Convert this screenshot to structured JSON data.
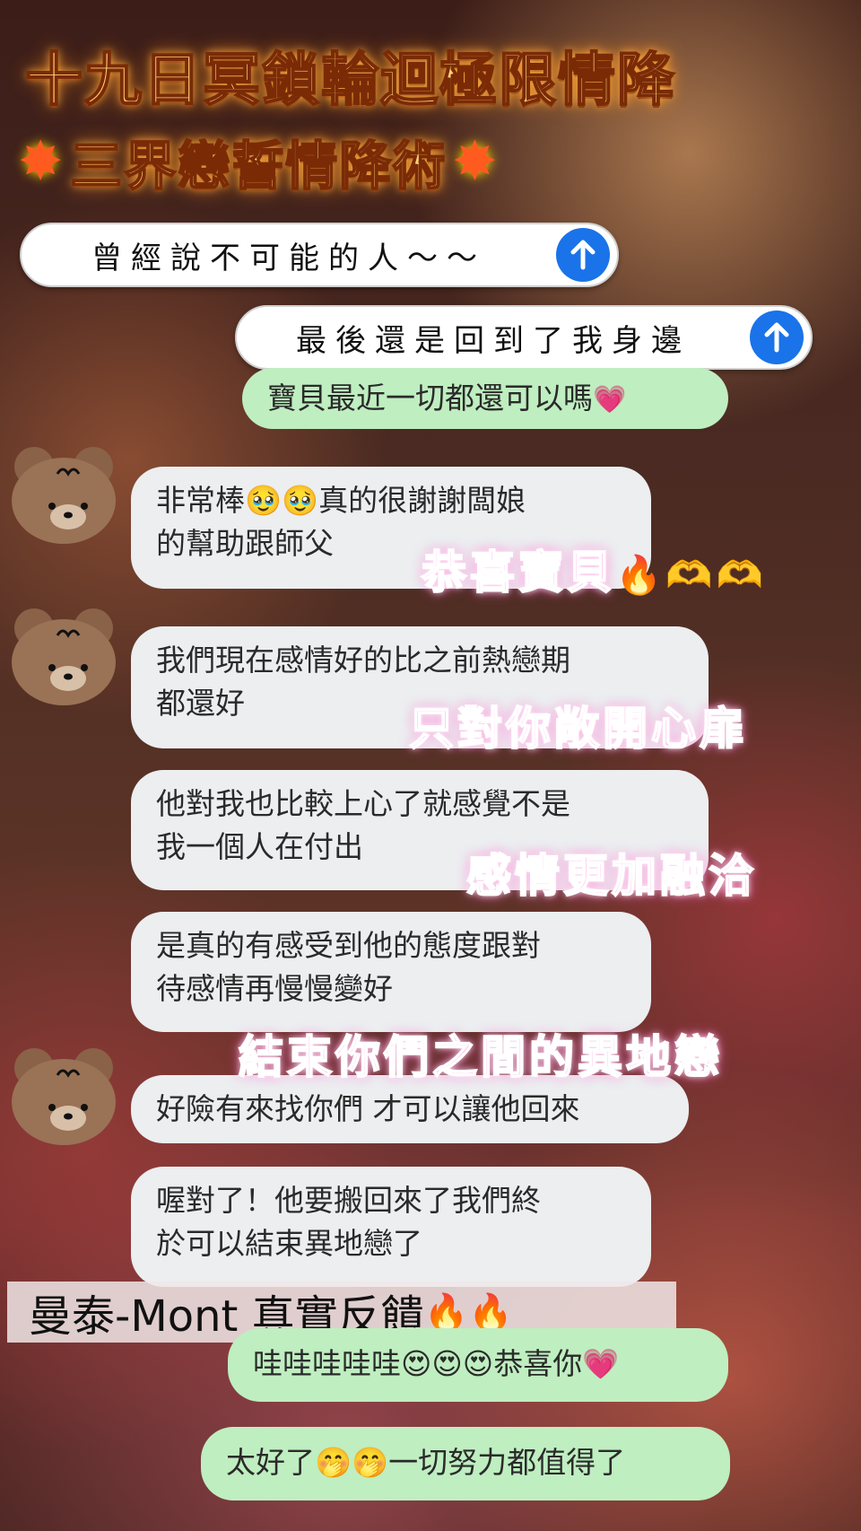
{
  "headline": {
    "line1": "十九日冥鎖輪迴極限情降",
    "line2": "三界戀誓情降術",
    "spark_icon": "✸"
  },
  "pills": [
    {
      "text": "曾經說不可能的人～～"
    },
    {
      "text": "最後還是回到了我身邊"
    }
  ],
  "messages": [
    {
      "type": "green",
      "text": "寶貝最近一切都還可以嗎",
      "emoji": "💗"
    },
    {
      "type": "gray",
      "line1": "非常棒🥹🥹真的很謝謝闆娘",
      "line2": "的幫助跟師父"
    },
    {
      "type": "gray",
      "line1": "我們現在感情好的比之前熱戀期",
      "line2": "都還好"
    },
    {
      "type": "gray",
      "line1": "他對我也比較上心了就感覺不是",
      "line2": "我一個人在付出"
    },
    {
      "type": "gray",
      "line1": "是真的有感受到他的態度跟對",
      "line2": "待感情再慢慢變好"
    },
    {
      "type": "gray",
      "text": "好險有來找你們 才可以讓他回來"
    },
    {
      "type": "gray",
      "line1": "喔對了！他要搬回來了我們終",
      "line2": "於可以結束異地戀了"
    },
    {
      "type": "green",
      "text": "哇哇哇哇哇😍😍😍恭喜你💗"
    },
    {
      "type": "green",
      "text": "太好了🤭🤭一切努力都值得了"
    }
  ],
  "captions": {
    "c1": "恭喜寶貝",
    "c1_emoji": "🔥🫶🫶",
    "c2": "只對你敞開心扉",
    "c3": "感情更加融洽",
    "c4": "結束你們之間的異地戀"
  },
  "brand": {
    "text": "曼泰-Mont 真實反饋",
    "emoji": "🔥🔥"
  },
  "colors": {
    "send_button": "#1a73e8",
    "green_bubble": "#bfeec0",
    "gray_bubble": "#eceef0",
    "caption": "#ff7ad8",
    "headline": "#ffd27a"
  }
}
